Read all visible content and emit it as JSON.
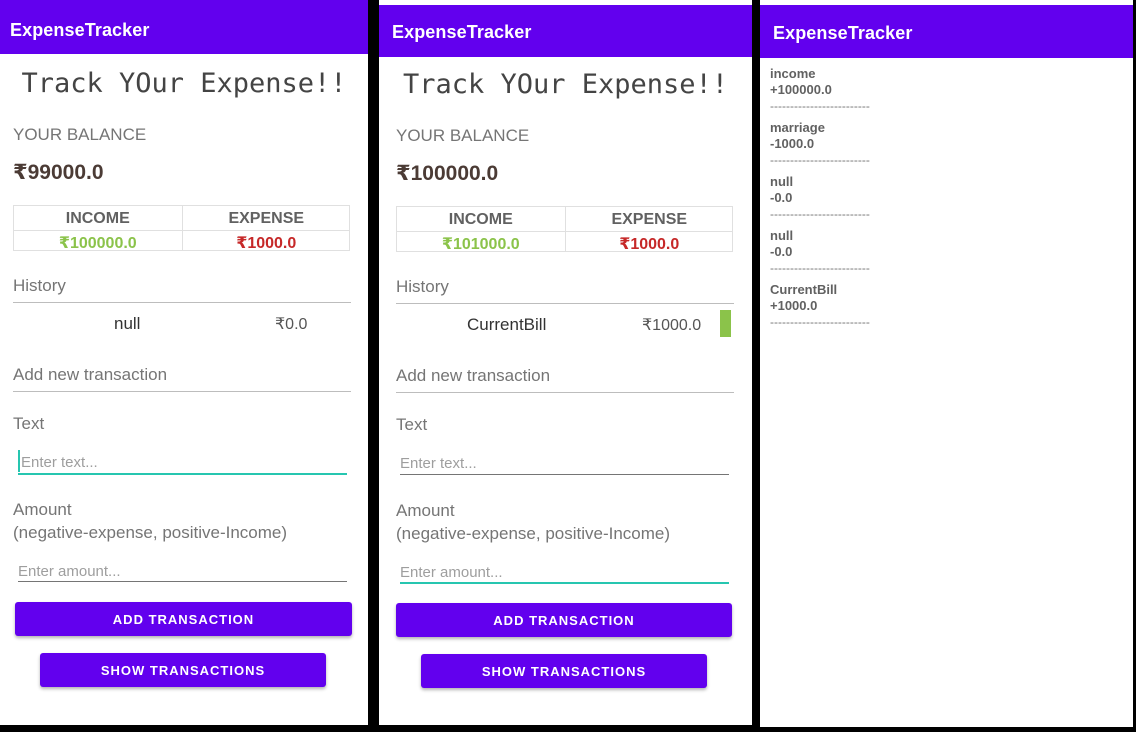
{
  "app_title": "ExpenseTracker",
  "heading": "Track YOur Expense!!",
  "balance_label": "YOUR BALANCE",
  "income_header": "INCOME",
  "expense_header": "EXPENSE",
  "history_label": "History",
  "add_transaction_label": "Add new transaction",
  "text_label": "Text",
  "amount_label": "Amount",
  "amount_hint": "(negative-expense, positive-Income)",
  "text_placeholder": "Enter text...",
  "amount_placeholder": "Enter amount...",
  "add_button_label": "ADD TRANSACTION",
  "show_button_label": "SHOW TRANSACTIONS",
  "separator": "-------------------------",
  "colors": {
    "accent": "#6200ee",
    "income": "#8bc34a",
    "expense": "#c62828",
    "input_focus": "#26c6b0"
  },
  "screen1": {
    "balance": "₹99000.0",
    "income": "₹100000.0",
    "expense": "₹1000.0",
    "history": [
      {
        "text": "null",
        "amount": "₹0.0"
      }
    ]
  },
  "screen2": {
    "balance": "₹100000.0",
    "income": "₹101000.0",
    "expense": "₹1000.0",
    "history": [
      {
        "text": "CurrentBill",
        "amount": "₹1000.0",
        "indicator_color": "#8bc34a"
      }
    ]
  },
  "screen3": {
    "transactions": [
      {
        "text": "income",
        "amount": "+100000.0"
      },
      {
        "text": "marriage",
        "amount": "-1000.0"
      },
      {
        "text": "null",
        "amount": "-0.0"
      },
      {
        "text": "null",
        "amount": "-0.0"
      },
      {
        "text": "CurrentBill",
        "amount": "+1000.0"
      }
    ]
  }
}
